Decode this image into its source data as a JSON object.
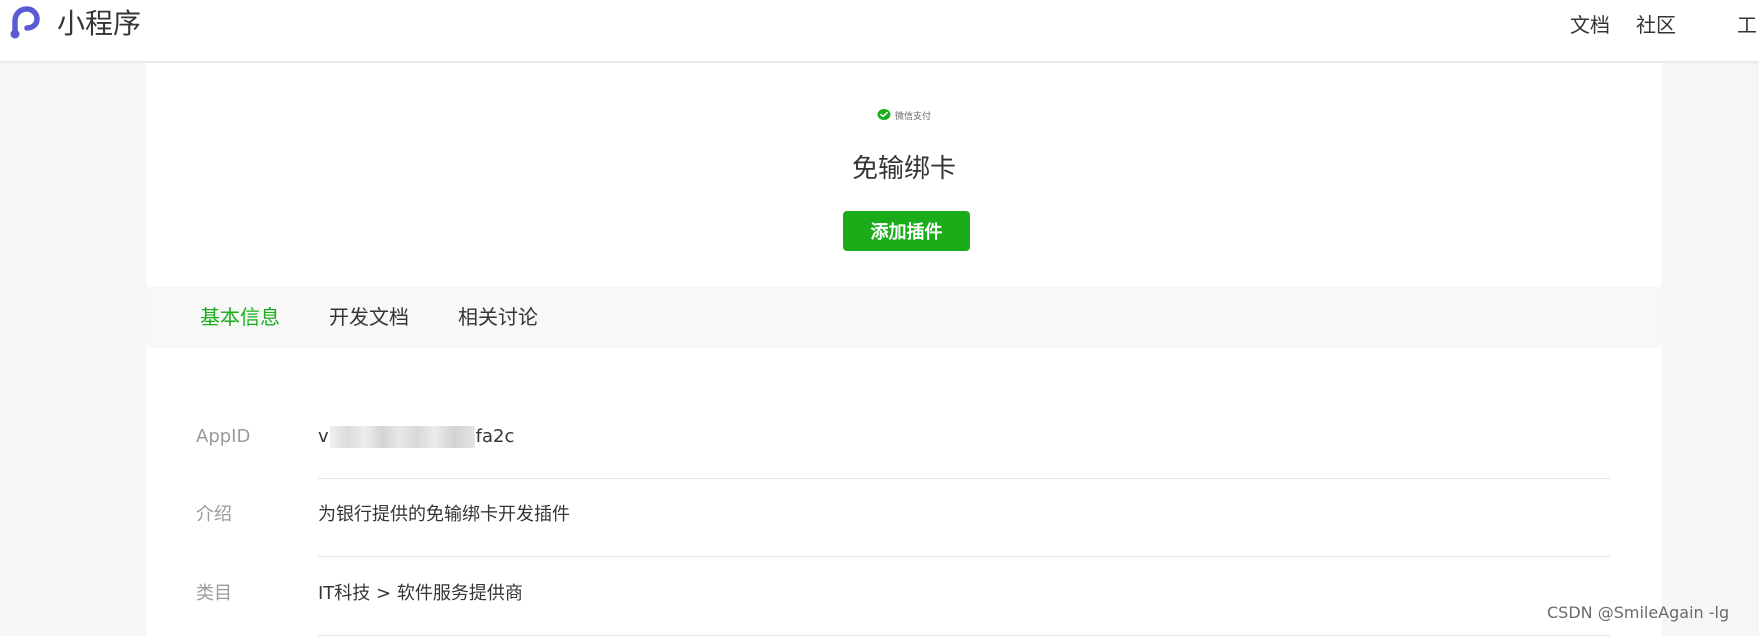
{
  "header": {
    "brand": "小程序",
    "nav": [
      "文档",
      "社区",
      "工"
    ]
  },
  "plugin": {
    "provider_logo_text": "微信支付",
    "title": "免输绑卡",
    "add_button_label": "添加插件"
  },
  "tabs": [
    {
      "label": "基本信息",
      "active": true
    },
    {
      "label": "开发文档",
      "active": false
    },
    {
      "label": "相关讨论",
      "active": false
    }
  ],
  "info": {
    "appid": {
      "label": "AppID",
      "value_prefix": "v",
      "value_suffix": "fa2c"
    },
    "intro": {
      "label": "介绍",
      "value": "为银行提供的免输绑卡开发插件"
    },
    "category": {
      "label": "类目",
      "value": "IT科技 > 软件服务提供商"
    }
  },
  "watermark": "CSDN @SmileAgain -lg",
  "colors": {
    "accent": "#1aad19",
    "logo": "#5b5bd6"
  }
}
